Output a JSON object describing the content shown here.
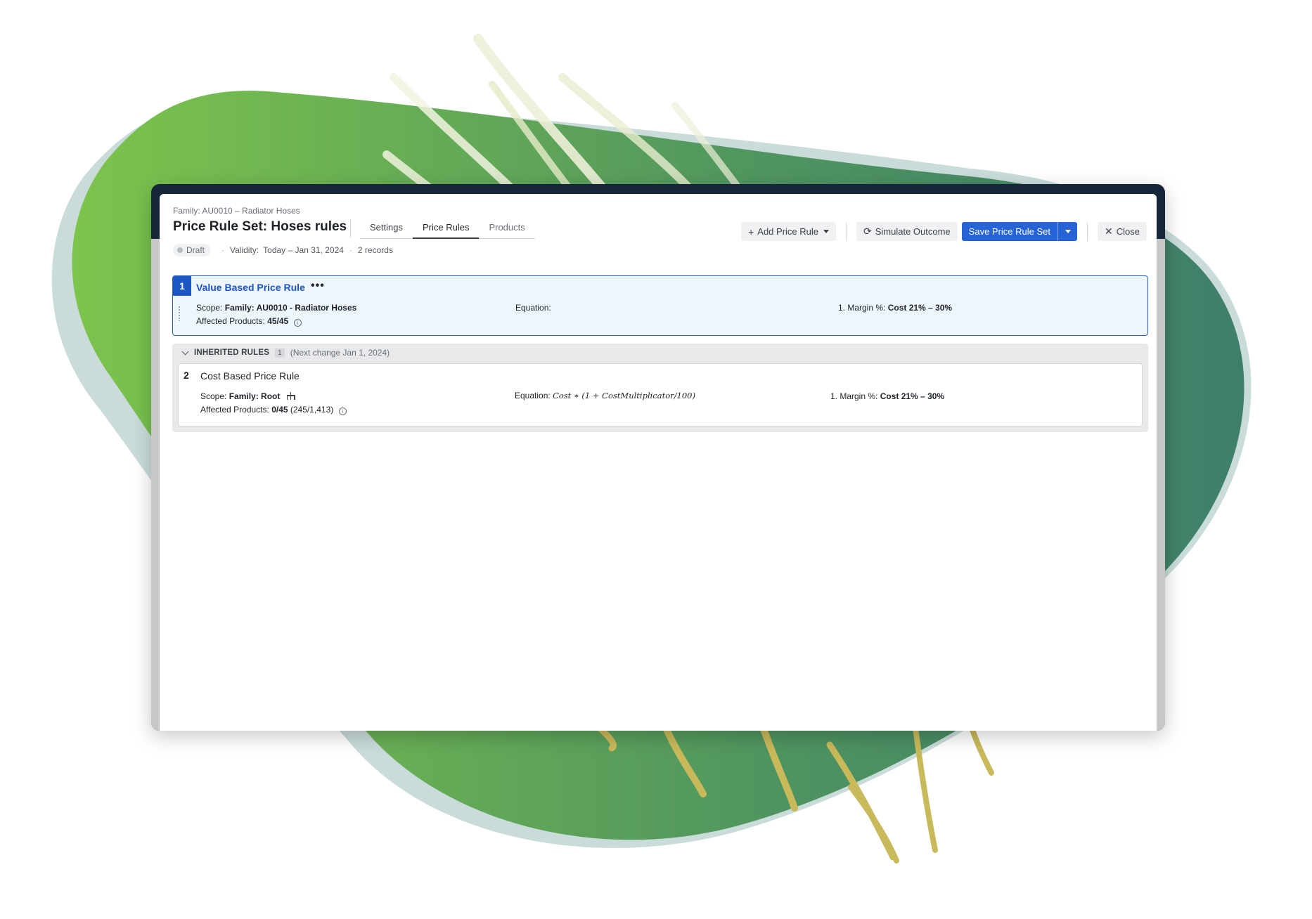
{
  "header": {
    "breadcrumb": "Family: AU0010 – Radiator Hoses",
    "title": "Price Rule Set: Hoses rules",
    "tabs": [
      {
        "label": "Settings"
      },
      {
        "label": "Price Rules",
        "active": true
      },
      {
        "label": "Products"
      }
    ],
    "status": {
      "badge": "Draft",
      "validity_label": "Validity:",
      "validity_value": "Today – Jan 31, 2024",
      "records": "2 records"
    }
  },
  "toolbar": {
    "add_price_rule": "Add Price Rule",
    "simulate_outcome": "Simulate Outcome",
    "save_price_rule_set": "Save Price Rule Set",
    "close": "Close"
  },
  "rules": [
    {
      "number": "1",
      "name": "Value Based Price Rule",
      "scope_label": "Scope:",
      "scope_value": "Family: AU0010 - Radiator Hoses",
      "affected_label": "Affected Products:",
      "affected_value": "45/45",
      "equation_label": "Equation:",
      "equation_value": "",
      "margin_label": "1. Margin %:",
      "margin_value": "Cost 21% – 30%"
    }
  ],
  "inherited": {
    "label": "INHERITED RULES",
    "count": "1",
    "next_change": "(Next change Jan 1, 2024)",
    "rules": [
      {
        "number": "2",
        "name": "Cost Based Price Rule",
        "scope_label": "Scope:",
        "scope_value": "Family: Root",
        "affected_label": "Affected Products:",
        "affected_value": "0/45",
        "affected_extra": "(245/1,413)",
        "equation_label": "Equation:",
        "equation_value": "Cost ∗ (1 + CostMultiplicator/100)",
        "margin_label": "1. Margin %:",
        "margin_value": "Cost 21% – 30%"
      }
    ]
  },
  "colors": {
    "accent": "#2563d6",
    "window_frame": "#17253a",
    "blob_green_light": "#7cc44c",
    "blob_green_dark": "#3f7f6a"
  },
  "icons": [
    "plus-icon",
    "caret-down-icon",
    "refresh-icon",
    "close-icon",
    "more-icon",
    "info-icon",
    "chevron-down-icon",
    "hierarchy-icon",
    "drag-handle-icon"
  ]
}
